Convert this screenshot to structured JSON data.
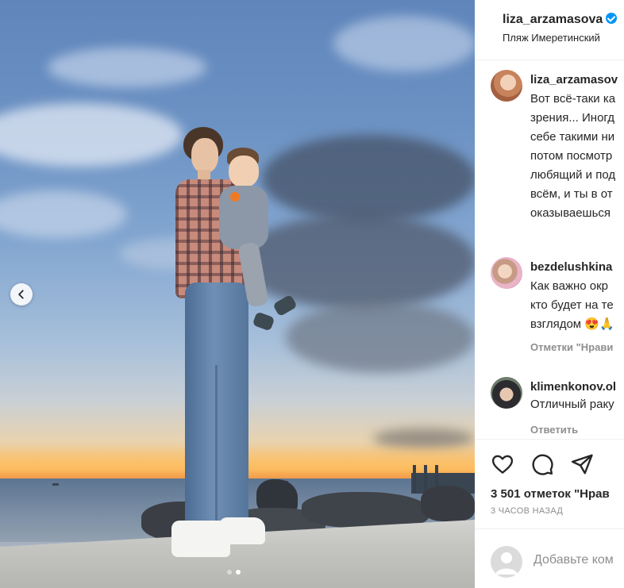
{
  "post": {
    "author": "liza_arzamasova",
    "verified": true,
    "location": "Пляж Имеретинский",
    "carousel": {
      "slide_count": 2,
      "active_slide": 2
    }
  },
  "caption": {
    "username": "liza_arzamasov",
    "lines": [
      "Вот всё-таки ка",
      "зрения... Иногд",
      "себе такими ни",
      "потом посмотр",
      "любящий и под",
      "всём, и ты в от",
      "оказываешься"
    ]
  },
  "comments": [
    {
      "username": "bezdelushkina",
      "lines": [
        "Как важно окр",
        "кто будет на те",
        "взглядом 😍🙏"
      ],
      "meta": "Отметки \"Нрави"
    },
    {
      "username": "klimenkonov.ol",
      "lines": [
        "Отличный раку"
      ],
      "meta": "Ответить"
    }
  ],
  "actions": {
    "like_icon": "heart-icon",
    "comment_icon": "comment-bubble-icon",
    "share_icon": "paper-plane-icon"
  },
  "stats": {
    "likes": "3 501 отметок \"Нрав",
    "time": "3 ЧАСОВ НАЗАД"
  },
  "composer": {
    "placeholder": "Добавьте ком"
  },
  "colors": {
    "verified_blue": "#0095f6",
    "text": "#262626",
    "muted": "#8e8e8e"
  }
}
